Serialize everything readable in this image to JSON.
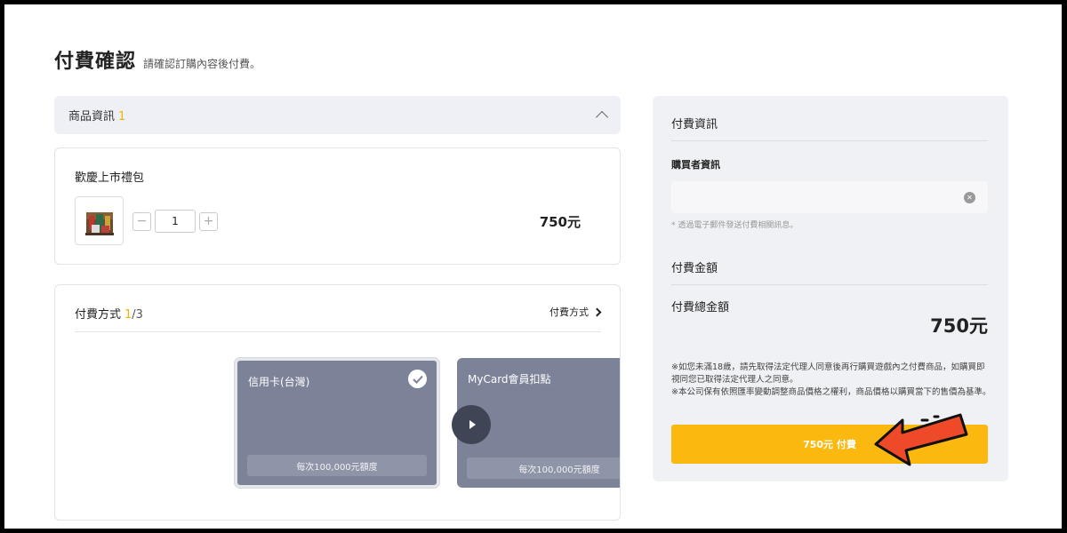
{
  "header": {
    "title": "付費確認",
    "subtitle": "請確認訂購內容後付費。"
  },
  "product_section": {
    "title": "商品資訊",
    "count": "1",
    "item": {
      "name": "歡慶上市禮包",
      "quantity": "1",
      "price": "750元",
      "minus": "−",
      "plus": "+"
    }
  },
  "payment_section": {
    "title": "付費方式",
    "selected_index": "1",
    "total_methods": "/3",
    "link_label": "付費方式",
    "methods": [
      {
        "name": "信用卡(台灣)",
        "limit": "每次100,000元額度",
        "selected": true
      },
      {
        "name": "MyCard會員扣點",
        "limit": "每次100,000元額度",
        "selected": false
      }
    ]
  },
  "right_panel": {
    "section_title": "付費資訊",
    "buyer_label": "購買者資訊",
    "email_value": "",
    "email_hint": "* 透過電子郵件發送付費相關訊息。",
    "amount_section": "付費金額",
    "total_label": "付費總金額",
    "total_amount": "750元",
    "notice_1": "※如您未滿18歲，請先取得法定代理人同意後再行購買遊戲內之付費商品，如購買即視同您已取得法定代理人之同意。",
    "notice_2": "※本公司保有依照匯率變動調整商品價格之權利，商品價格以購買當下的售價為基準。",
    "pay_button": "750元 付費"
  },
  "colors": {
    "accent": "#fbb80f",
    "count_highlight": "#f0b400",
    "method_card": "#7c8399",
    "annotation_arrow": "#ee4a2a"
  },
  "icons": [
    "chevron-up-icon",
    "chevron-right-icon",
    "check-icon",
    "play-arrow-icon",
    "clear-icon",
    "gift-box-icon",
    "pointer-arrow-icon"
  ]
}
